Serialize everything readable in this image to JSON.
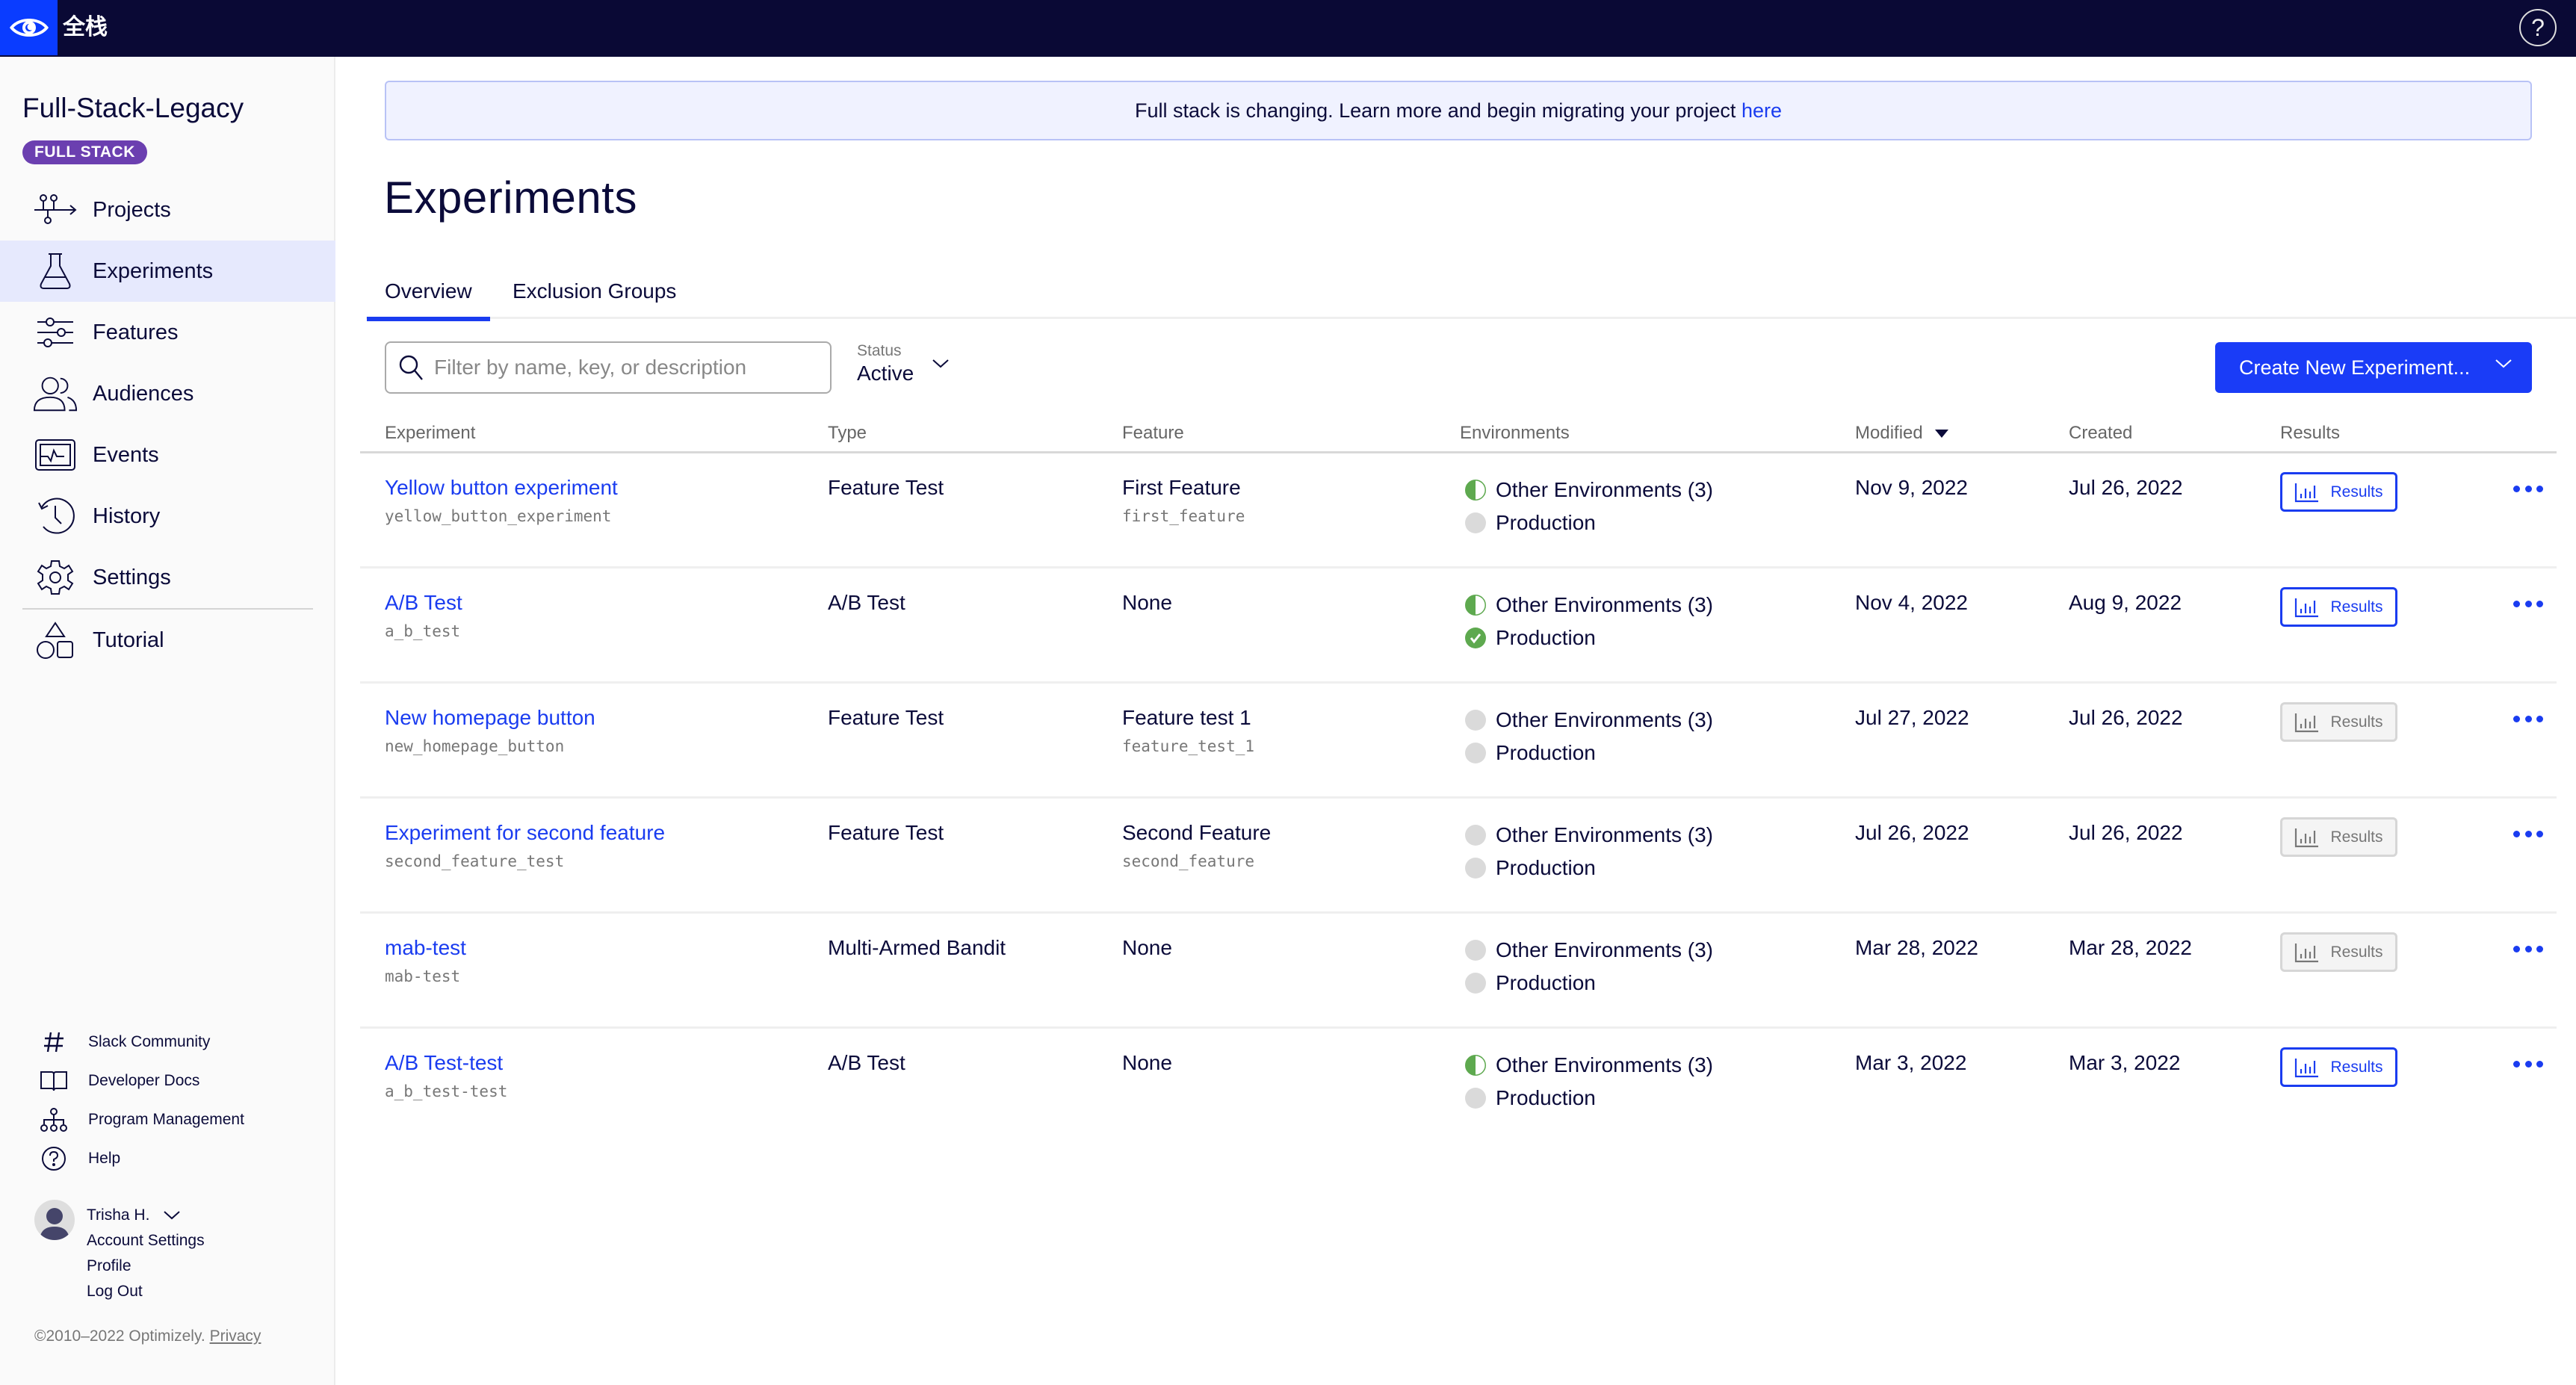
{
  "topbar": {
    "logo": "optimizely-eye-logo",
    "app_title": "全栈",
    "help_icon": "help-circle-icon"
  },
  "sidebar": {
    "project_name": "Full-Stack-Legacy",
    "project_badge": "FULL STACK",
    "nav": [
      {
        "label": "Projects",
        "icon": "projects-icon",
        "active": false
      },
      {
        "label": "Experiments",
        "icon": "flask-icon",
        "active": true
      },
      {
        "label": "Features",
        "icon": "sliders-icon",
        "active": false
      },
      {
        "label": "Audiences",
        "icon": "users-icon",
        "active": false
      },
      {
        "label": "Events",
        "icon": "events-monitor-icon",
        "active": false
      },
      {
        "label": "History",
        "icon": "history-icon",
        "active": false
      },
      {
        "label": "Settings",
        "icon": "gear-icon",
        "active": false
      },
      {
        "label": "Tutorial",
        "icon": "shapes-icon",
        "active": false
      }
    ],
    "bottom_links": [
      {
        "label": "Slack Community",
        "icon": "hash-icon"
      },
      {
        "label": "Developer Docs",
        "icon": "book-icon"
      },
      {
        "label": "Program Management",
        "icon": "org-chart-icon"
      },
      {
        "label": "Help",
        "icon": "help-circle-icon"
      }
    ],
    "user": {
      "name": "Trisha H.",
      "links": [
        "Account Settings",
        "Profile",
        "Log Out"
      ]
    },
    "copyright": "©2010–2022 Optimizely.",
    "privacy_link": "Privacy"
  },
  "banner": {
    "text": "Full stack is changing. Learn more and begin migrating your project ",
    "link": "here"
  },
  "page": {
    "title": "Experiments",
    "tabs": [
      {
        "label": "Overview",
        "active": true
      },
      {
        "label": "Exclusion Groups",
        "active": false
      }
    ],
    "search": {
      "placeholder": "Filter by name, key, or description",
      "value": ""
    },
    "status_filter": {
      "label": "Status",
      "value": "Active"
    },
    "create_button": "Create New Experiment..."
  },
  "table": {
    "columns": [
      "Experiment",
      "Type",
      "Feature",
      "Environments",
      "Modified",
      "Created",
      "Results"
    ],
    "sorted_by": "Modified",
    "sort_direction": "desc",
    "colors": {
      "running": "#5ea94f",
      "off": "#dadada",
      "link": "#1a3cf0"
    },
    "rows": [
      {
        "name": "Yellow button experiment",
        "key": "yellow_button_experiment",
        "type": "Feature Test",
        "feature": "First Feature",
        "feature_key": "first_feature",
        "environments": [
          {
            "label": "Other Environments (3)",
            "status": "partial"
          },
          {
            "label": "Production",
            "status": "off"
          }
        ],
        "modified": "Nov 9, 2022",
        "created": "Jul 26, 2022",
        "results_label": "Results",
        "results_enabled": true
      },
      {
        "name": "A/B Test",
        "key": "a_b_test",
        "type": "A/B Test",
        "feature": "None",
        "feature_key": "",
        "environments": [
          {
            "label": "Other Environments (3)",
            "status": "partial"
          },
          {
            "label": "Production",
            "status": "running"
          }
        ],
        "modified": "Nov 4, 2022",
        "created": "Aug 9, 2022",
        "results_label": "Results",
        "results_enabled": true
      },
      {
        "name": "New homepage button",
        "key": "new_homepage_button",
        "type": "Feature Test",
        "feature": "Feature test 1",
        "feature_key": "feature_test_1",
        "environments": [
          {
            "label": "Other Environments (3)",
            "status": "off"
          },
          {
            "label": "Production",
            "status": "off"
          }
        ],
        "modified": "Jul 27, 2022",
        "created": "Jul 26, 2022",
        "results_label": "Results",
        "results_enabled": false
      },
      {
        "name": "Experiment for second feature",
        "key": "second_feature_test",
        "type": "Feature Test",
        "feature": "Second Feature",
        "feature_key": "second_feature",
        "environments": [
          {
            "label": "Other Environments (3)",
            "status": "off"
          },
          {
            "label": "Production",
            "status": "off"
          }
        ],
        "modified": "Jul 26, 2022",
        "created": "Jul 26, 2022",
        "results_label": "Results",
        "results_enabled": false
      },
      {
        "name": "mab-test",
        "key": "mab-test",
        "type": "Multi-Armed Bandit",
        "feature": "None",
        "feature_key": "",
        "environments": [
          {
            "label": "Other Environments (3)",
            "status": "off"
          },
          {
            "label": "Production",
            "status": "off"
          }
        ],
        "modified": "Mar 28, 2022",
        "created": "Mar 28, 2022",
        "results_label": "Results",
        "results_enabled": false
      },
      {
        "name": "A/B Test-test",
        "key": "a_b_test-test",
        "type": "A/B Test",
        "feature": "None",
        "feature_key": "",
        "environments": [
          {
            "label": "Other Environments (3)",
            "status": "partial"
          },
          {
            "label": "Production",
            "status": "off"
          }
        ],
        "modified": "Mar 3, 2022",
        "created": "Mar 3, 2022",
        "results_label": "Results",
        "results_enabled": true
      }
    ]
  }
}
